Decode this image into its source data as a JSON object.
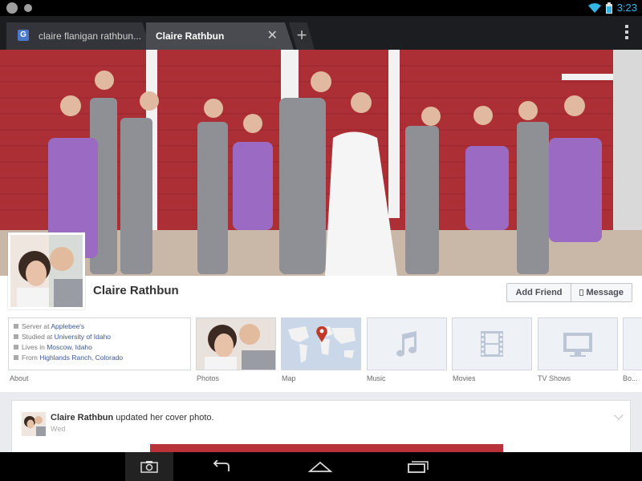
{
  "status_bar": {
    "time": "3:23"
  },
  "browser": {
    "tabs": [
      {
        "label": "claire flanigan rathbun...",
        "favicon": "G"
      },
      {
        "label": "Claire Rathbun",
        "close": "✕"
      }
    ],
    "new_tab": "+"
  },
  "profile": {
    "name": "Claire Rathbun",
    "add_friend_label": "Add Friend",
    "message_label": "Message"
  },
  "about": {
    "items": [
      {
        "prefix": "Server at ",
        "link": "Applebee's"
      },
      {
        "prefix": "Studied at ",
        "link": "University of Idaho"
      },
      {
        "prefix": "Lives in ",
        "link": "Moscow, Idaho"
      },
      {
        "prefix": "From ",
        "link": "Highlands Ranch, Colorado"
      }
    ],
    "label": "About"
  },
  "tiles": {
    "photos": "Photos",
    "map": "Map",
    "music": "Music",
    "movies": "Movies",
    "tvshows": "TV Shows",
    "extra": "Bo..."
  },
  "post": {
    "author": "Claire Rathbun",
    "action": " updated her cover photo.",
    "time": "Wed"
  },
  "colors": {
    "facebook_blue": "#3b5998",
    "barn_red": "#b8323a",
    "dress_purple": "#9b6ac2",
    "holo_blue": "#33b5e5"
  }
}
